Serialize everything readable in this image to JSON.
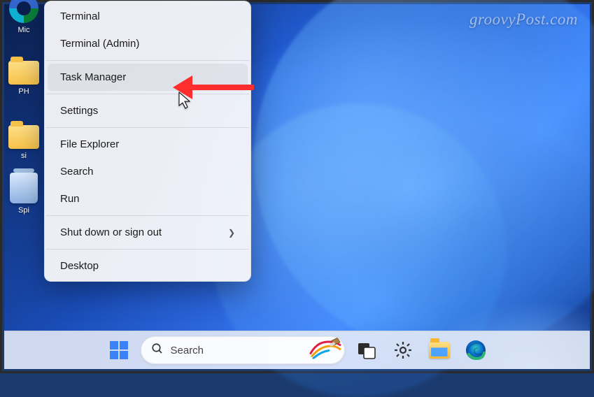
{
  "watermark": "groovyPost.com",
  "desktop_icons": {
    "i0": "Mic",
    "i1": "PH",
    "i2": "si",
    "i3": "Spi"
  },
  "menu": {
    "terminal": "Terminal",
    "terminal_admin": "Terminal (Admin)",
    "task_manager": "Task Manager",
    "settings": "Settings",
    "file_explorer": "File Explorer",
    "search": "Search",
    "run": "Run",
    "shutdown": "Shut down or sign out",
    "desktop": "Desktop"
  },
  "taskbar": {
    "search_placeholder": "Search"
  }
}
